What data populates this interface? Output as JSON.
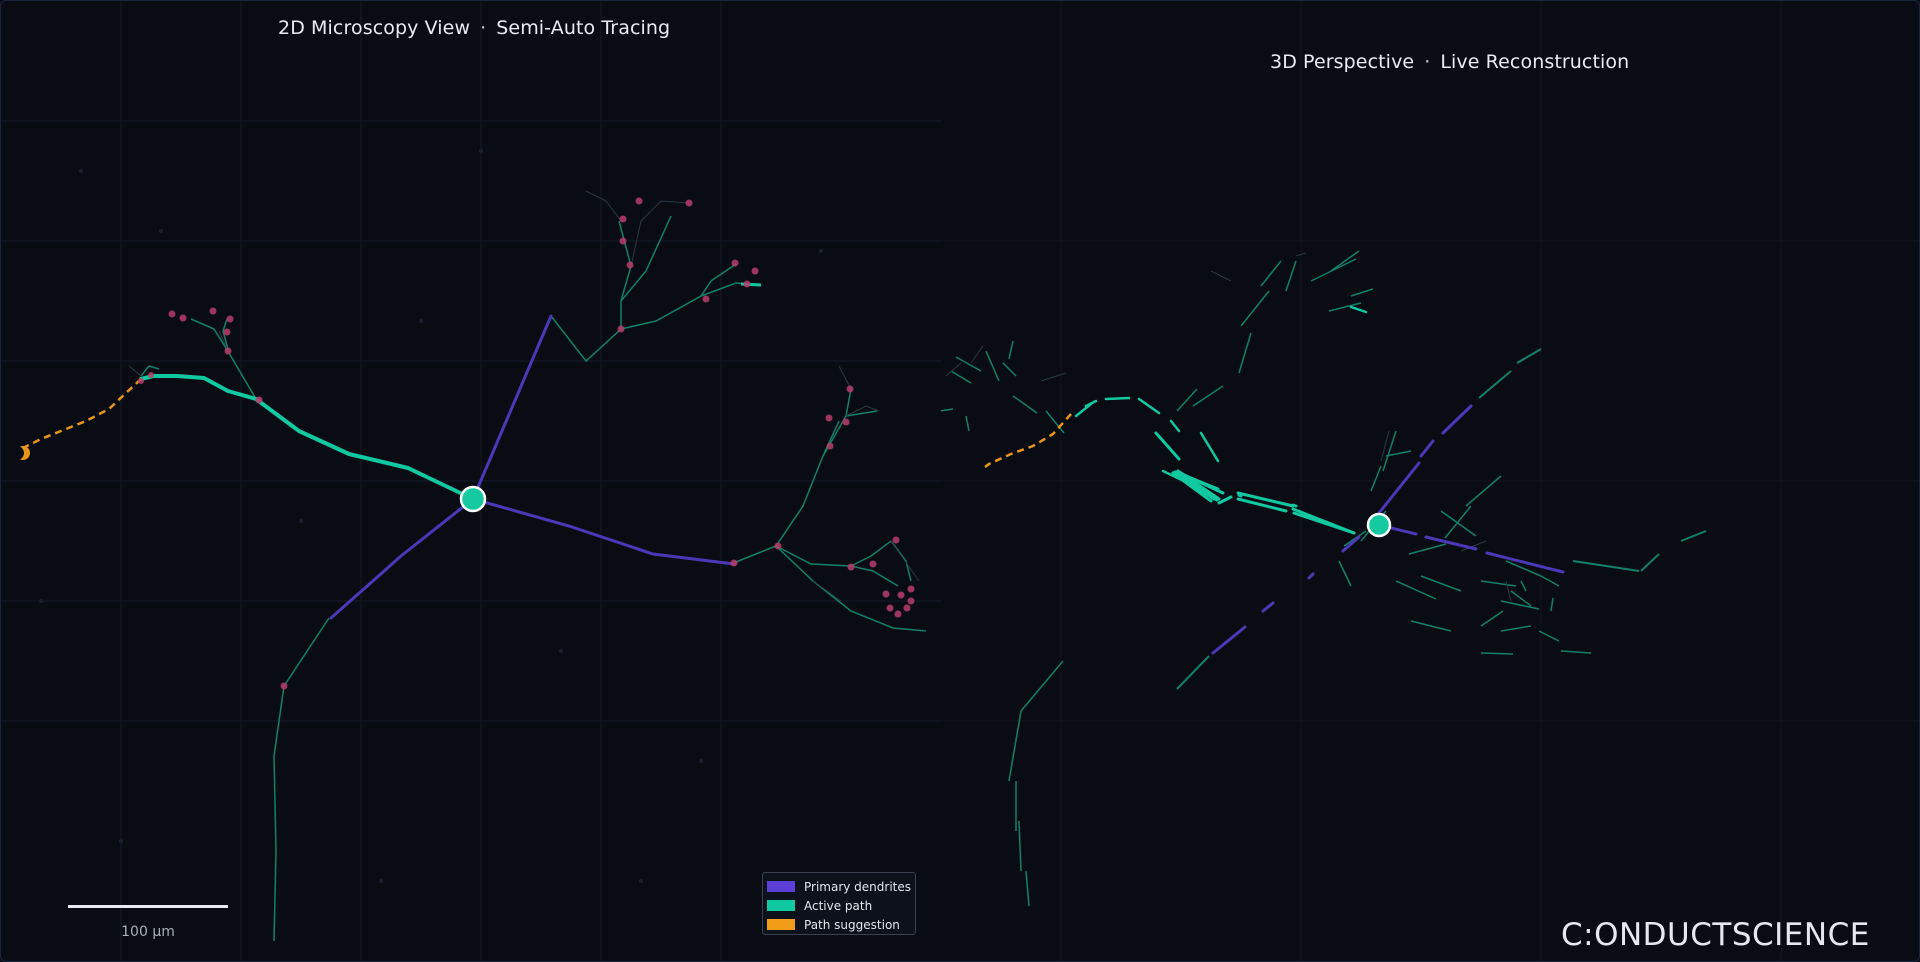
{
  "left_panel": {
    "title_main": "2D Microscopy View",
    "title_separator": "·",
    "title_mode": "Semi-Auto Tracing",
    "scale_label": "100 μm"
  },
  "right_panel": {
    "title_main": "3D Perspective",
    "title_separator": "·",
    "title_mode": "Live Reconstruction"
  },
  "legend": {
    "items": [
      {
        "label": "Primary dendrites",
        "color": "#5b3fd6"
      },
      {
        "label": "Active path",
        "color": "#11c9a0"
      },
      {
        "label": "Path suggestion",
        "color": "#f39c18"
      }
    ]
  },
  "brand": {
    "logo_text": "C:ONDUCTSCIENCE"
  },
  "colors": {
    "background": "#0a0c14",
    "primary_dendrite": "#4b38b8",
    "active_path": "#11c9a0",
    "secondary_branch": "#12806a",
    "path_suggestion": "#e8961a",
    "marker": "#b83d6a",
    "soma": "#15c9a0"
  },
  "icons": [
    "soma-node-icon",
    "suggestion-endpoint-icon"
  ]
}
